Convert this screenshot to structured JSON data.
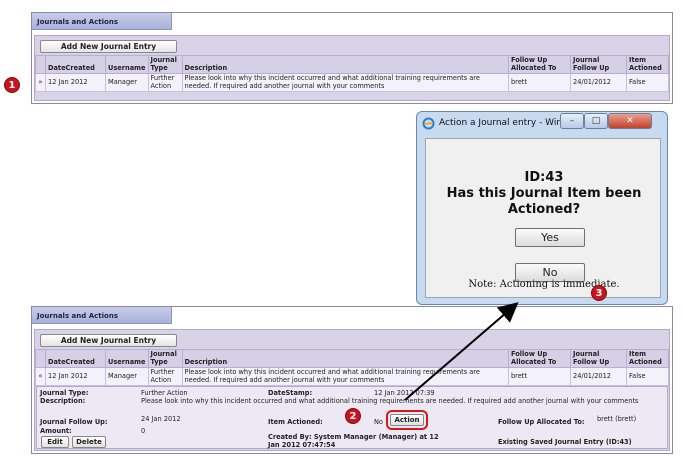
{
  "panel_title": "Journals and Actions",
  "add_button": "Add New Journal Entry",
  "columns": [
    "DateCreated",
    "Username",
    "Journal Type",
    "Description",
    "Follow Up Allocated To",
    "Journal Follow Up",
    "Item Actioned"
  ],
  "row": {
    "date": "12 Jan 2012",
    "user": "Manager",
    "type": "Further Action",
    "desc": "Please look into why this incident occurred and what additional training requirements are needed. If required add another journal with your comments",
    "follow": "brett",
    "followup": "24/01/2012",
    "actioned": "False"
  },
  "expand_icon_top": "»",
  "expand_icon_bottom": "«",
  "badges": {
    "one": "1",
    "two": "2",
    "three": "3"
  },
  "detail": {
    "journal_type_label": "Journal Type:",
    "journal_type": "Further Action",
    "datestamp_label": "DateStamp:",
    "datestamp": "12 Jan 2012 07:39",
    "description_label": "Description:",
    "description": "Please look into why this incident occurred and what additional training requirements are needed. If required add another journal with your comments",
    "followup_label": "Journal Follow Up:",
    "followup": "24 Jan 2012",
    "actioned_label": "Item Actioned:",
    "actioned_value": "No",
    "action_button": "Action",
    "allocated_label": "Follow Up Allocated To:",
    "allocated": "brett (brett)",
    "amount_label": "Amount:",
    "amount": "0",
    "edit": "Edit",
    "delete": "Delete",
    "created_by": "Created By: System Manager (Manager) at 12 Jan 2012 07:47:54",
    "existing": "Existing Saved Journal Entry (ID:43)"
  },
  "dialog": {
    "title": "Action a Journal entry - Window...",
    "id_line": "ID:43",
    "question": [
      "Has this Journal Item been",
      "Actioned?"
    ],
    "yes": "Yes",
    "no": "No",
    "note": "Note: Actioning is immediate."
  },
  "colors": {
    "badge": "#c8141c",
    "highlight": "#d21a1a",
    "arrow": "#000000"
  }
}
